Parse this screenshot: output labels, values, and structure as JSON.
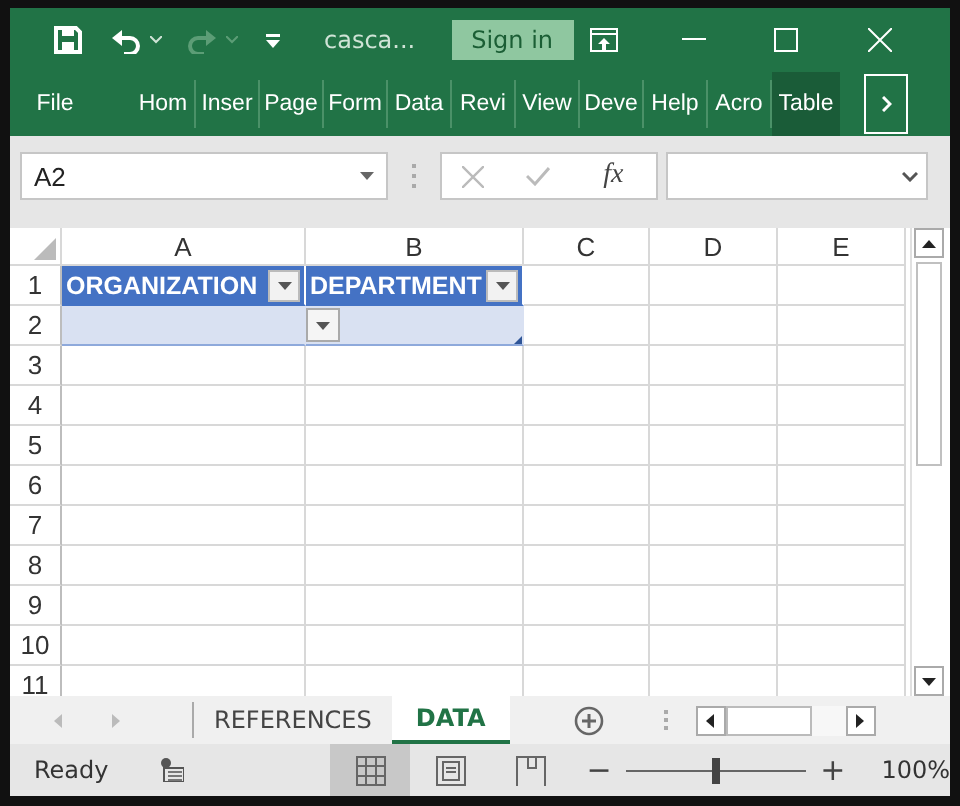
{
  "title_bar": {
    "filename": "casca...",
    "sign_in": "Sign in"
  },
  "ribbon_tabs": [
    {
      "label": "File",
      "selected": false
    },
    {
      "label": "Hom",
      "selected": false
    },
    {
      "label": "Inser",
      "selected": false
    },
    {
      "label": "Page",
      "selected": false
    },
    {
      "label": "Form",
      "selected": false
    },
    {
      "label": "Data",
      "selected": false
    },
    {
      "label": "Revi",
      "selected": false
    },
    {
      "label": "View",
      "selected": false
    },
    {
      "label": "Deve",
      "selected": false
    },
    {
      "label": "Help",
      "selected": false
    },
    {
      "label": "Acro",
      "selected": false
    },
    {
      "label": "Table",
      "selected": true
    }
  ],
  "formula_bar": {
    "name_box": "A2",
    "function_label": "fx"
  },
  "sheet": {
    "columns": [
      "A",
      "B",
      "C",
      "D",
      "E"
    ],
    "rows": [
      "1",
      "2",
      "3",
      "4",
      "5",
      "6",
      "7",
      "8",
      "9",
      "10",
      "11"
    ],
    "table_headers": [
      {
        "text": "ORGANIZATION"
      },
      {
        "text": "DEPARTMENT"
      }
    ]
  },
  "sheet_tabs": [
    {
      "label": "REFERENCES",
      "selected": false
    },
    {
      "label": "DATA",
      "selected": true
    }
  ],
  "status_bar": {
    "status": "Ready",
    "views": [
      {
        "kind": "normal",
        "selected": true
      },
      {
        "kind": "page_layout",
        "selected": false
      },
      {
        "kind": "page_break",
        "selected": false
      }
    ],
    "zoom_out": "−",
    "zoom_in": "+",
    "zoom": {
      "level": 0.5,
      "reading": "100%"
    }
  }
}
